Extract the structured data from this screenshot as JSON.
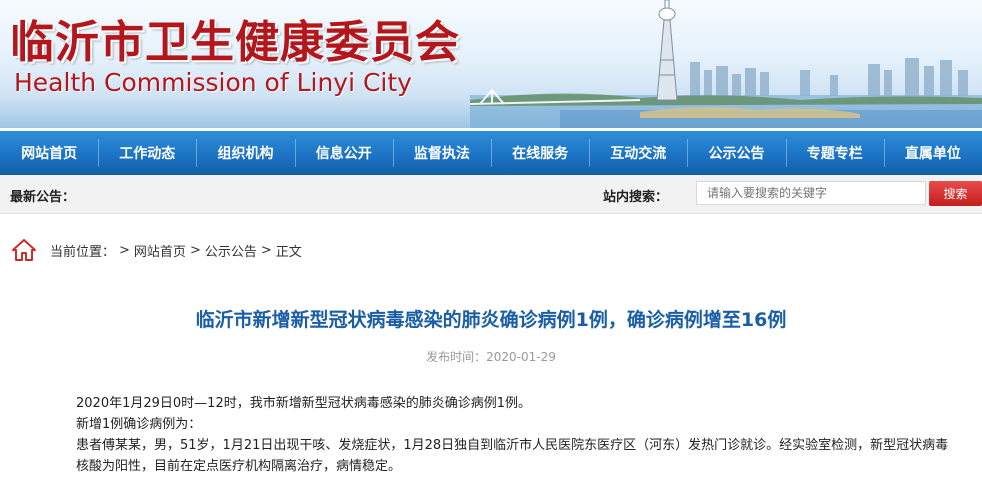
{
  "header": {
    "title": "临沂市卫生健康委员会",
    "subtitle": "Health Commission of Linyi City"
  },
  "nav": {
    "items": [
      {
        "label": "网站首页"
      },
      {
        "label": "工作动态"
      },
      {
        "label": "组织机构"
      },
      {
        "label": "信息公开"
      },
      {
        "label": "监督执法"
      },
      {
        "label": "在线服务"
      },
      {
        "label": "互动交流"
      },
      {
        "label": "公示公告"
      },
      {
        "label": "专题专栏"
      },
      {
        "label": "直属单位"
      }
    ]
  },
  "announcement": {
    "label": "最新公告："
  },
  "search": {
    "label": "站内搜索：",
    "placeholder": "请输入要搜索的关键字",
    "button": "搜索"
  },
  "breadcrumb": {
    "label": "当前位置：",
    "separator": ">",
    "items": [
      "网站首页",
      "公示公告",
      "正文"
    ]
  },
  "article": {
    "title": "临沂市新增新型冠状病毒感染的肺炎确诊病例1例，确诊病例增至16例",
    "date_label": "发布时间：",
    "date": "2020-01-29",
    "paragraphs": [
      "2020年1月29日0时—12时，我市新增新型冠状病毒感染的肺炎确诊病例1例。",
      "新增1例确诊病例为：",
      "患者傅某某，男，51岁，1月21日出现干咳、发烧症状，1月28日独自到临沂市人民医院东医疗区（河东）发热门诊就诊。经实验室检测，新型冠状病毒核酸为阳性，目前在定点医疗机构隔离治疗，病情稳定。"
    ]
  },
  "colors": {
    "brand_red": "#b3161b",
    "nav_blue": "#1c73c4",
    "title_blue": "#1a5ea8",
    "search_button": "#d62a2a"
  },
  "icons": {
    "home": "home-icon"
  }
}
